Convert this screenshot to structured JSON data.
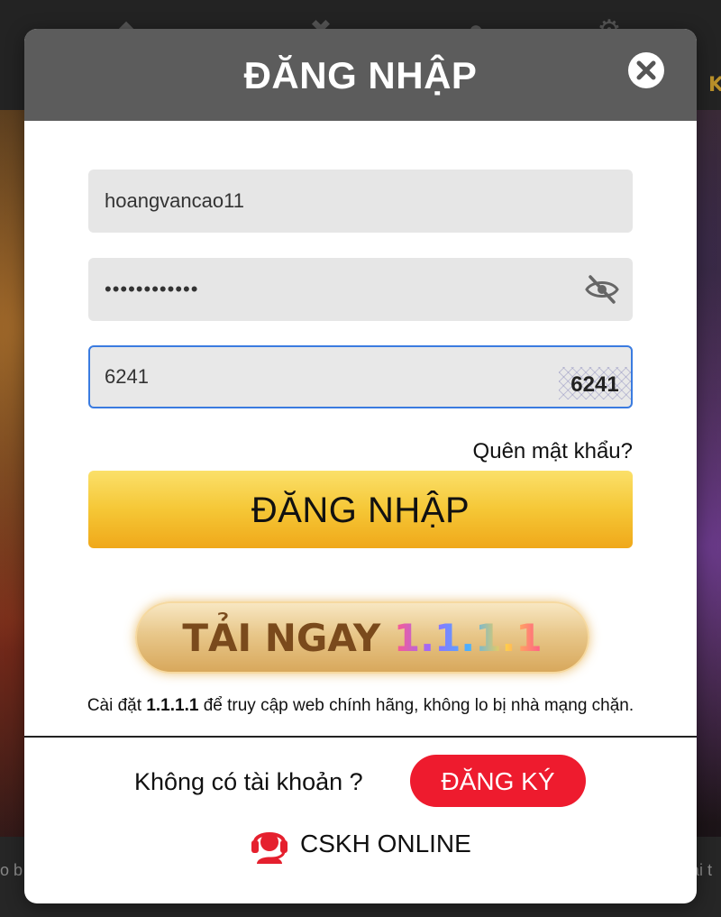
{
  "modal": {
    "title": "ĐĂNG NHẬP",
    "close_icon": "close-icon"
  },
  "form": {
    "username_value": "hoangvancao11",
    "password_masked": "••••••••••••",
    "password_toggle_icon": "eye-slash-icon",
    "captcha_value": "6241",
    "captcha_image_text": "6241",
    "forgot_label": "Quên mật khẩu?",
    "login_label": "ĐĂNG NHẬP"
  },
  "download": {
    "label_main": "TẢI NGAY",
    "label_version": "1.1.1.1",
    "note_prefix": "Cài đặt",
    "note_bold": "1.1.1.1",
    "note_suffix": "để truy cập web chính hãng, không lo bị nhà mạng chặn."
  },
  "footer": {
    "no_account_label": "Không có tài khoản ?",
    "register_label": "ĐĂNG KÝ",
    "support_label": "CSKH ONLINE",
    "support_icon": "headset-icon"
  },
  "background": {
    "right_text": "K",
    "bottom_left_text": "o b",
    "bottom_right_text": "ải t"
  },
  "colors": {
    "header_bg": "#5c5c5c",
    "login_button": "#f5c736",
    "register_button": "#ee1b2e",
    "captcha_border": "#3a7be0"
  }
}
